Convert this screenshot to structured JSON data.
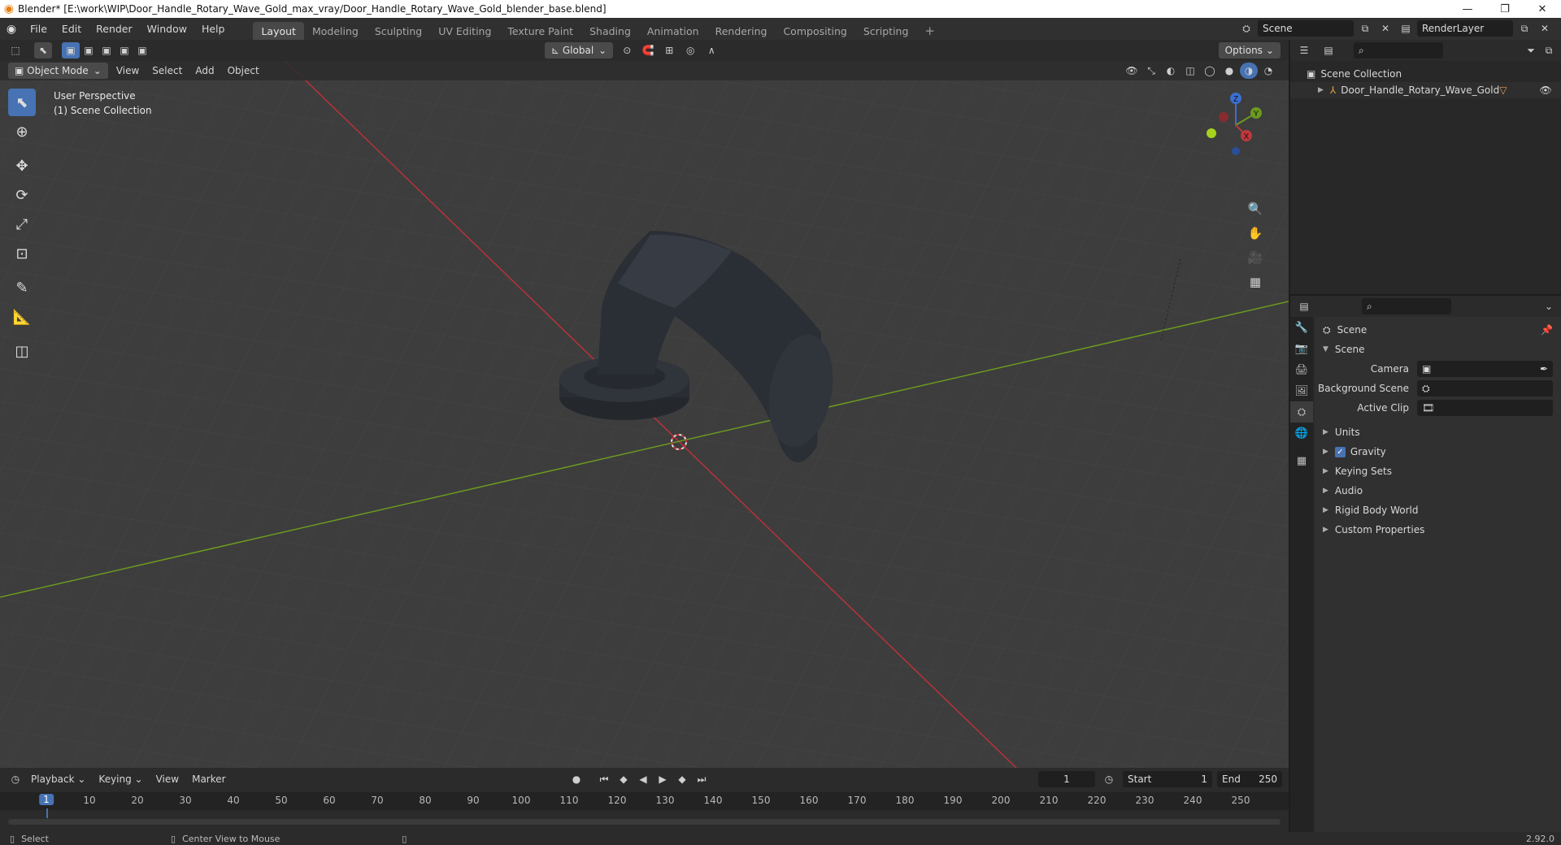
{
  "window": {
    "title": "Blender* [E:\\work\\WIP\\Door_Handle_Rotary_Wave_Gold_max_vray/Door_Handle_Rotary_Wave_Gold_blender_base.blend]",
    "minimize": "—",
    "restore": "❐",
    "close": "✕"
  },
  "menu": [
    "File",
    "Edit",
    "Render",
    "Window",
    "Help"
  ],
  "workspaces": [
    "Layout",
    "Modeling",
    "Sculpting",
    "UV Editing",
    "Texture Paint",
    "Shading",
    "Animation",
    "Rendering",
    "Compositing",
    "Scripting"
  ],
  "workspace_add": "+",
  "scene_selector": {
    "scene": "Scene",
    "view_layer": "RenderLayer"
  },
  "viewport": {
    "mode": "Object Mode",
    "menus": [
      "View",
      "Select",
      "Add",
      "Object"
    ],
    "transform_orientation": "Global",
    "options": "Options",
    "overlay_line1": "User Perspective",
    "overlay_line2": "(1) Scene Collection",
    "gizmo": {
      "x": "X",
      "y": "Y",
      "z": "Z"
    },
    "colors": {
      "x_axis": "#b8323a",
      "y_axis": "#6c9a20",
      "background": "#3d3d3d",
      "grid": "#484848",
      "object": "#2a2e35"
    }
  },
  "timeline": {
    "menus": [
      "Playback",
      "Keying",
      "View",
      "Marker"
    ],
    "current_frame": "1",
    "start_label": "Start",
    "start": "1",
    "end_label": "End",
    "end": "250",
    "ticks": [
      "10",
      "20",
      "30",
      "40",
      "50",
      "60",
      "70",
      "80",
      "90",
      "100",
      "110",
      "120",
      "130",
      "140",
      "150",
      "160",
      "170",
      "180",
      "190",
      "200",
      "210",
      "220",
      "230",
      "240",
      "250"
    ]
  },
  "status": {
    "select": "Select",
    "center": "Center View to Mouse",
    "version": "2.92.0"
  },
  "outliner": {
    "root": "Scene Collection",
    "object": "Door_Handle_Rotary_Wave_Gold"
  },
  "properties": {
    "title": "Scene",
    "section": "Scene",
    "camera_label": "Camera",
    "background_label": "Background Scene",
    "clip_label": "Active Clip",
    "panels": [
      "Units",
      "Gravity",
      "Keying Sets",
      "Audio",
      "Rigid Body World",
      "Custom Properties"
    ]
  }
}
